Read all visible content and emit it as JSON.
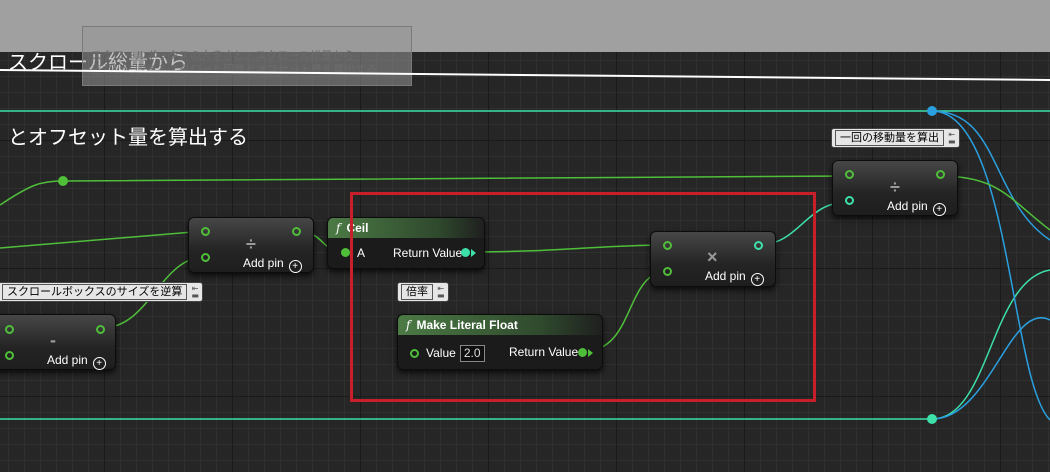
{
  "comment": {
    "title_lines": [
      "スクロール総量から",
      "とオフセット量を算出する"
    ],
    "tooltip_lines": [
      "スクロールボックスの大きさと、スクロール総量から",
      "きれいに収まるスクロール回数とオフセット量を算出する"
    ]
  },
  "bubbles": {
    "scroll_size_reverse": "スクロールボックスのサイズを逆算",
    "rate": "倍率",
    "move_amount": "一回の移動量を算出"
  },
  "nodes": {
    "subtract": {
      "operator": "-",
      "add_pin": "Add pin"
    },
    "divide1": {
      "operator": "÷",
      "add_pin": "Add pin"
    },
    "ceil": {
      "title": "Ceil",
      "input_label": "A",
      "output_label": "Return Value"
    },
    "make_literal_float": {
      "title": "Make Literal Float",
      "input_label": "Value",
      "value": "2.0",
      "output_label": "Return Value"
    },
    "multiply": {
      "operator": "×",
      "add_pin": "Add pin"
    },
    "divide2": {
      "operator": "÷",
      "add_pin": "Add pin"
    }
  },
  "colors": {
    "float_wire": "#4fbf3a",
    "int_wire": "#3de0a8",
    "struct_wire": "#2aa0e0",
    "selection": "#c8202a"
  },
  "icons": {
    "function": "f",
    "add_pin": "plus-circle"
  }
}
